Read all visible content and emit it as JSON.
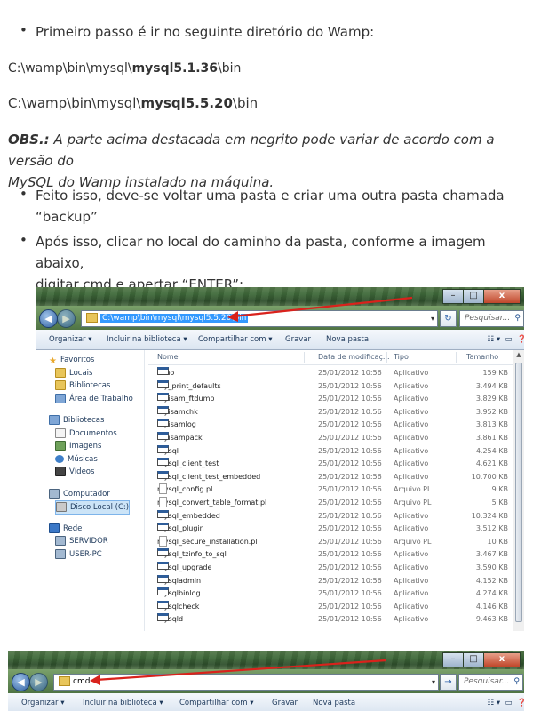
{
  "bullets_top": [
    {
      "text": "Primeiro passo é ir no seguinte diretório do Wamp:"
    }
  ],
  "paths": [
    {
      "prefix": "C:\\wamp\\bin\\mysql\\",
      "bold": "mysql5.1.36",
      "suffix": "\\bin"
    },
    {
      "prefix": "C:\\wamp\\bin\\mysql\\",
      "bold": "mysql5.5.20",
      "suffix": "\\bin"
    }
  ],
  "obs": {
    "label": "OBS.:",
    "line1": " A parte acima destacada em negrito pode variar de acordo com a versão do",
    "line2": "MySQL do Wamp instalado na máquina."
  },
  "bullets": [
    {
      "line1": "Feito isso, deve-se voltar uma pasta e criar uma outra pasta chamada",
      "line2": "“backup”"
    },
    {
      "line1": "Após isso, clicar no local do caminho da pasta, conforme a imagem abaixo,",
      "line2": "digitar cmd e apertar “ENTER”:"
    }
  ],
  "explorer1": {
    "address": "C:\\wamp\\bin\\mysql\\mysql5.5.20\\bin",
    "search_placeholder": "Pesquisar...",
    "toolbar": [
      "Organizar ▾",
      "Incluir na biblioteca ▾",
      "Compartilhar com ▾",
      "Gravar",
      "Nova pasta"
    ],
    "columns": [
      "Nome",
      "Data de modificaç...",
      "Tipo",
      "Tamanho"
    ],
    "nav": [
      {
        "label": "Favoritos",
        "icon": "star",
        "level": 0
      },
      {
        "label": "Locais",
        "icon": "fold",
        "level": 1
      },
      {
        "label": "Bibliotecas",
        "icon": "fold",
        "level": 1
      },
      {
        "label": "Área de Trabalho",
        "icon": "lib",
        "level": 1
      },
      {
        "label": "",
        "icon": "",
        "level": 0
      },
      {
        "label": "Bibliotecas",
        "icon": "lib",
        "level": 0
      },
      {
        "label": "Documentos",
        "icon": "doc",
        "level": 1
      },
      {
        "label": "Imagens",
        "icon": "img",
        "level": 1
      },
      {
        "label": "Músicas",
        "icon": "mus",
        "level": 1
      },
      {
        "label": "Vídeos",
        "icon": "vid",
        "level": 1
      },
      {
        "label": "",
        "icon": "",
        "level": 0
      },
      {
        "label": "Computador",
        "icon": "pc",
        "level": 0
      },
      {
        "label": "Disco Local (C:)",
        "icon": "disk",
        "level": 1
      },
      {
        "label": "",
        "icon": "",
        "level": 0
      },
      {
        "label": "Rede",
        "icon": "net",
        "level": 0
      },
      {
        "label": "SERVIDOR",
        "icon": "pc",
        "level": 1
      },
      {
        "label": "USER-PC",
        "icon": "pc",
        "level": 1
      }
    ],
    "files": [
      {
        "name": "echo",
        "date": "25/01/2012 10:56",
        "type": "Aplicativo",
        "size": "159 KB",
        "kind": "app"
      },
      {
        "name": "my_print_defaults",
        "date": "25/01/2012 10:56",
        "type": "Aplicativo",
        "size": "3.494 KB",
        "kind": "app"
      },
      {
        "name": "myisam_ftdump",
        "date": "25/01/2012 10:56",
        "type": "Aplicativo",
        "size": "3.829 KB",
        "kind": "app"
      },
      {
        "name": "myisamchk",
        "date": "25/01/2012 10:56",
        "type": "Aplicativo",
        "size": "3.952 KB",
        "kind": "app"
      },
      {
        "name": "myisamlog",
        "date": "25/01/2012 10:56",
        "type": "Aplicativo",
        "size": "3.813 KB",
        "kind": "app"
      },
      {
        "name": "myisampack",
        "date": "25/01/2012 10:56",
        "type": "Aplicativo",
        "size": "3.861 KB",
        "kind": "app"
      },
      {
        "name": "mysql",
        "date": "25/01/2012 10:56",
        "type": "Aplicativo",
        "size": "4.254 KB",
        "kind": "app"
      },
      {
        "name": "mysql_client_test",
        "date": "25/01/2012 10:56",
        "type": "Aplicativo",
        "size": "4.621 KB",
        "kind": "app"
      },
      {
        "name": "mysql_client_test_embedded",
        "date": "25/01/2012 10:56",
        "type": "Aplicativo",
        "size": "10.700 KB",
        "kind": "app"
      },
      {
        "name": "mysql_config.pl",
        "date": "25/01/2012 10:56",
        "type": "Arquivo PL",
        "size": "9 KB",
        "kind": "pl"
      },
      {
        "name": "mysql_convert_table_format.pl",
        "date": "25/01/2012 10:56",
        "type": "Arquivo PL",
        "size": "5 KB",
        "kind": "pl"
      },
      {
        "name": "mysql_embedded",
        "date": "25/01/2012 10:56",
        "type": "Aplicativo",
        "size": "10.324 KB",
        "kind": "app"
      },
      {
        "name": "mysql_plugin",
        "date": "25/01/2012 10:56",
        "type": "Aplicativo",
        "size": "3.512 KB",
        "kind": "app"
      },
      {
        "name": "mysql_secure_installation.pl",
        "date": "25/01/2012 10:56",
        "type": "Arquivo PL",
        "size": "10 KB",
        "kind": "pl"
      },
      {
        "name": "mysql_tzinfo_to_sql",
        "date": "25/01/2012 10:56",
        "type": "Aplicativo",
        "size": "3.467 KB",
        "kind": "app"
      },
      {
        "name": "mysql_upgrade",
        "date": "25/01/2012 10:56",
        "type": "Aplicativo",
        "size": "3.590 KB",
        "kind": "app"
      },
      {
        "name": "mysqladmin",
        "date": "25/01/2012 10:56",
        "type": "Aplicativo",
        "size": "4.152 KB",
        "kind": "app"
      },
      {
        "name": "mysqlbinlog",
        "date": "25/01/2012 10:56",
        "type": "Aplicativo",
        "size": "4.274 KB",
        "kind": "app"
      },
      {
        "name": "mysqlcheck",
        "date": "25/01/2012 10:56",
        "type": "Aplicativo",
        "size": "4.146 KB",
        "kind": "app"
      },
      {
        "name": "mysqld",
        "date": "25/01/2012 10:56",
        "type": "Aplicativo",
        "size": "9.463 KB",
        "kind": "app"
      }
    ]
  },
  "explorer2": {
    "address": "cmd",
    "search_placeholder": "Pesquisar...",
    "toolbar": [
      "Organizar ▾",
      "Incluir na biblioteca ▾",
      "Compartilhar com ▾",
      "Gravar",
      "Nova pasta"
    ]
  },
  "colors": {
    "arrow": "#d9221c",
    "selection": "#3399ff"
  }
}
